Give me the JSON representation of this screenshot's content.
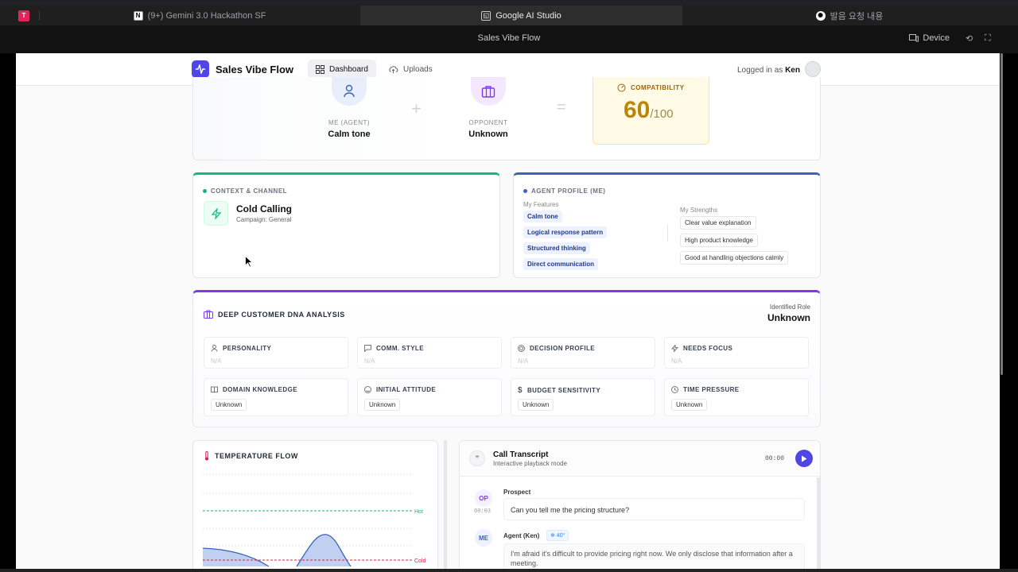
{
  "browser": {
    "tabs": [
      {
        "label": "(9+) Gemini 3.0 Hackathon SF",
        "icon": "notion-icon"
      },
      {
        "label": "Google AI Studio",
        "icon": "ai-studio-icon",
        "active": true
      },
      {
        "label": "발음 요청 내용",
        "icon": "chatgpt-icon"
      }
    ],
    "first_tab_glyph": "T"
  },
  "appbar": {
    "title": "Sales Vibe Flow",
    "device_label": "Device"
  },
  "nav": {
    "brand": "Sales Vibe Flow",
    "items": [
      {
        "label": "Dashboard",
        "icon": "grid-icon",
        "active": true
      },
      {
        "label": "Uploads",
        "icon": "cloud-upload-icon"
      }
    ],
    "logged_in_prefix": "Logged in as",
    "user": "Ken"
  },
  "match": {
    "me_label": "ME (AGENT)",
    "me_value": "Calm tone",
    "plus": "+",
    "opponent_label": "OPPONENT",
    "opponent_value": "Unknown",
    "equals": "=",
    "compat_label": "COMPATIBILITY",
    "compat_score": "60",
    "compat_max": "/100",
    "colors": {
      "score": "#b8860b",
      "compat_bg": "#fffbe6"
    }
  },
  "context": {
    "label": "CONTEXT & CHANNEL",
    "channel": "Cold Calling",
    "campaign": "Campaign: General"
  },
  "agent_profile": {
    "label": "AGENT PROFILE (ME)",
    "features_label": "My Features",
    "features": [
      "Calm tone",
      "Logical response pattern",
      "Structured thinking",
      "Direct communication"
    ],
    "strengths_label": "My Strengths",
    "strengths": [
      "Clear value explanation",
      "High product knowledge",
      "Good at handling objections calmly"
    ]
  },
  "dna": {
    "title": "DEEP CUSTOMER DNA ANALYSIS",
    "role_label": "Identified Role",
    "role_value": "Unknown",
    "row1": [
      {
        "label": "PERSONALITY",
        "value": "N/A",
        "icon": "person-icon"
      },
      {
        "label": "COMM. STYLE",
        "value": "N/A",
        "icon": "chat-icon"
      },
      {
        "label": "DECISION PROFILE",
        "value": "N/A",
        "icon": "target-icon"
      },
      {
        "label": "NEEDS FOCUS",
        "value": "N/A",
        "icon": "bolt-icon"
      }
    ],
    "row2": [
      {
        "label": "DOMAIN KNOWLEDGE",
        "value": "Unknown",
        "icon": "book-icon"
      },
      {
        "label": "INITIAL ATTITUDE",
        "value": "Unknown",
        "icon": "smile-icon"
      },
      {
        "label": "BUDGET SENSITIVITY",
        "value": "Unknown",
        "icon": "dollar-icon"
      },
      {
        "label": "TIME PRESSURE",
        "value": "Unknown",
        "icon": "clock-icon"
      }
    ]
  },
  "temperature": {
    "title": "TEMPERATURE FLOW",
    "hot_label": "Hot",
    "cold_label": "Cold"
  },
  "transcript": {
    "title": "Call Transcript",
    "subtitle": "Interactive playback mode",
    "time": "00:00",
    "messages": [
      {
        "avatar": "OP",
        "speaker": "Prospect",
        "timestamp": "00:03",
        "text": "Can you tell me the pricing structure?"
      },
      {
        "avatar": "ME",
        "speaker": "Agent (Ken)",
        "badge": "❄ 40°",
        "text": "I'm afraid it's difficult to provide pricing right now. We only disclose that information after a meeting."
      }
    ]
  }
}
